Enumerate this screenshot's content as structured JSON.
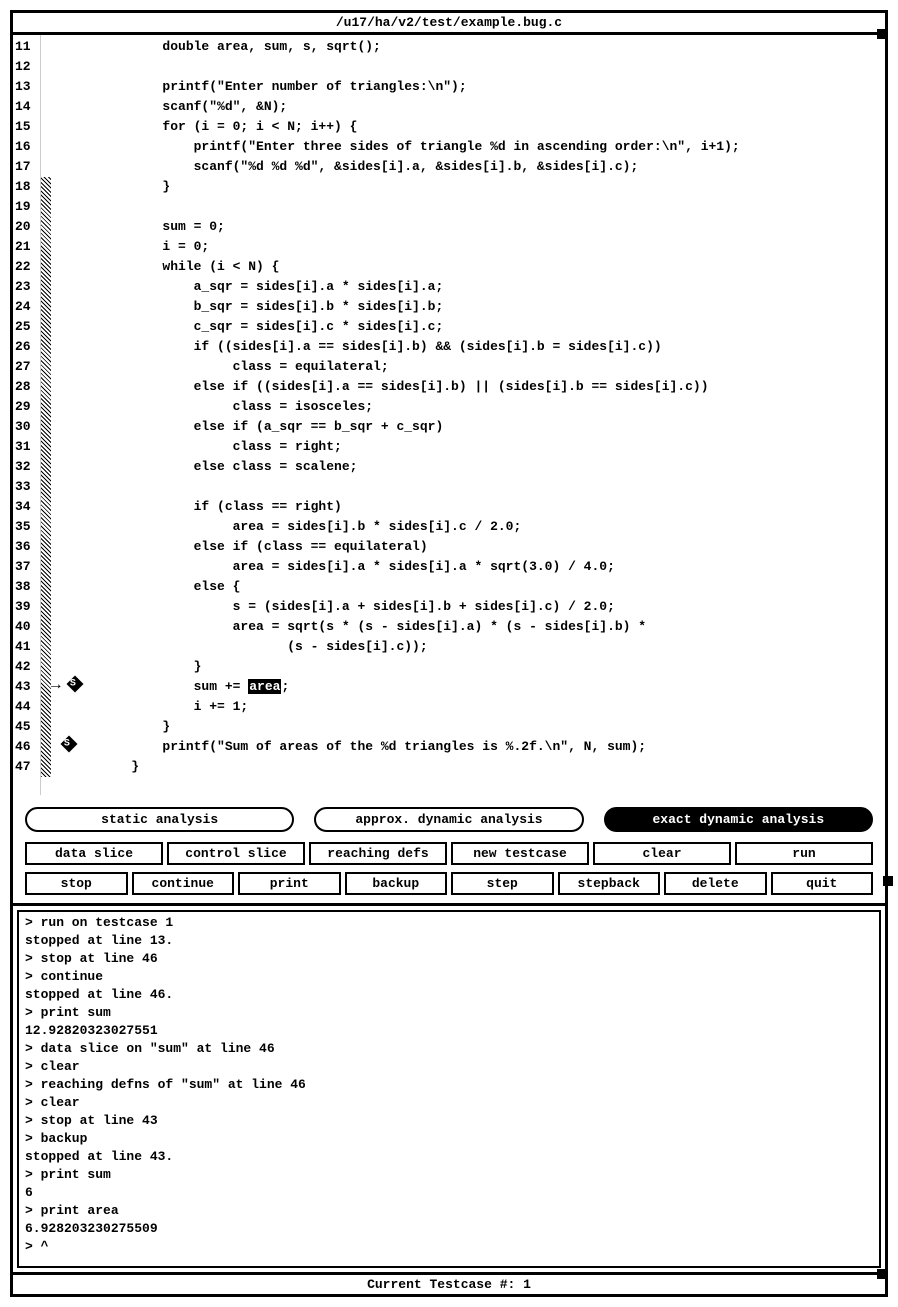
{
  "title": "/u17/ha/v2/test/example.bug.c",
  "status": "Current Testcase #: 1",
  "code": {
    "first_line_no": 11,
    "lines": [
      "        double area, sum, s, sqrt();",
      "",
      "        printf(\"Enter number of triangles:\\n\");",
      "        scanf(\"%d\", &N);",
      "        for (i = 0; i < N; i++) {",
      "            printf(\"Enter three sides of triangle %d in ascending order:\\n\", i+1);",
      "            scanf(\"%d %d %d\", &sides[i].a, &sides[i].b, &sides[i].c);",
      "        }",
      "",
      "        sum = 0;",
      "        i = 0;",
      "        while (i < N) {",
      "            a_sqr = sides[i].a * sides[i].a;",
      "            b_sqr = sides[i].b * sides[i].b;",
      "            c_sqr = sides[i].c * sides[i].c;",
      "            if ((sides[i].a == sides[i].b) && (sides[i].b = sides[i].c))",
      "                 class = equilateral;",
      "            else if ((sides[i].a == sides[i].b) || (sides[i].b == sides[i].c))",
      "                 class = isosceles;",
      "            else if (a_sqr == b_sqr + c_sqr)",
      "                 class = right;",
      "            else class = scalene;",
      "",
      "            if (class == right)",
      "                 area = sides[i].b * sides[i].c / 2.0;",
      "            else if (class == equilateral)",
      "                 area = sides[i].a * sides[i].a * sqrt(3.0) / 4.0;",
      "            else {",
      "                 s = (sides[i].a + sides[i].b + sides[i].c) / 2.0;",
      "                 area = sqrt(s * (s - sides[i].a) * (s - sides[i].b) *",
      "                        (s - sides[i].c));",
      "            }",
      "            sum += |area|;",
      "            i += 1;",
      "        }",
      "        printf(\"Sum of areas of the %d triangles is %.2f.\\n\", N, sum);",
      "    }"
    ],
    "focus_line": 43,
    "breakpoints": [
      43,
      46
    ],
    "hatch_from": 18,
    "hatch_to": 47
  },
  "analysis_tabs": {
    "static": "static analysis",
    "approx": "approx. dynamic analysis",
    "exact": "exact dynamic analysis",
    "active": "exact"
  },
  "row1": {
    "data_slice": "data slice",
    "control_slice": "control slice",
    "reaching_defs": "reaching defs",
    "new_testcase": "new testcase",
    "clear": "clear",
    "run": "run"
  },
  "row2": {
    "stop": "stop",
    "continue": "continue",
    "print": "print",
    "backup": "backup",
    "step": "step",
    "stepback": "stepback",
    "delete": "delete",
    "quit": "quit"
  },
  "console": [
    "> run on testcase 1",
    "stopped at line 13.",
    "> stop at line 46",
    "> continue",
    "stopped at line 46.",
    "> print sum",
    "12.92820323027551",
    "> data slice on \"sum\" at line 46",
    "> clear",
    "> reaching defns of \"sum\" at line 46",
    "> clear",
    "> stop at line 43",
    "> backup",
    "stopped at line 43.",
    "> print sum",
    "6",
    "> print area",
    "6.928203230275509",
    "> ^"
  ]
}
